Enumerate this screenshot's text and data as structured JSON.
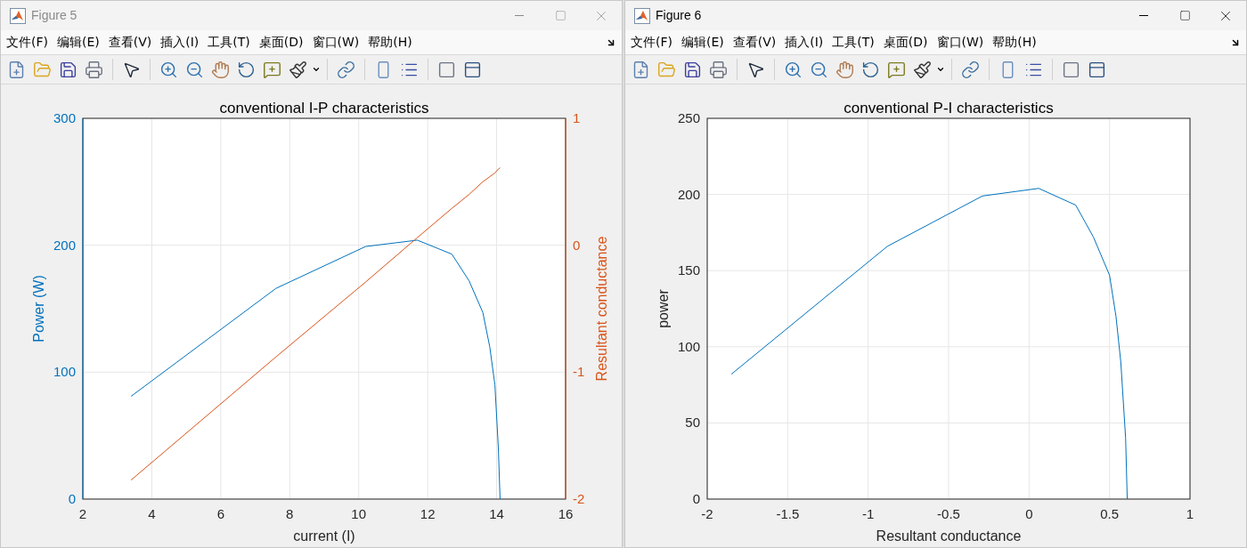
{
  "windows": [
    {
      "title": "Figure 5",
      "active": false,
      "menu": [
        "文件(F)",
        "编辑(E)",
        "查看(V)",
        "插入(I)",
        "工具(T)",
        "桌面(D)",
        "窗口(W)",
        "帮助(H)"
      ],
      "chart_data": {
        "type": "line",
        "title": "conventional I-P characteristics",
        "xlabel": "current (I)",
        "ylabel": "Power (W)",
        "y2label": "Resultant conductance",
        "x": [
          3.4,
          7.6,
          10.2,
          11.7,
          12.7,
          13.2,
          13.6,
          13.8,
          13.95,
          14.05,
          14.1
        ],
        "series": [
          {
            "color": "#0072bd",
            "values": [
              81,
              166,
              199,
              204,
              193,
              172,
              147,
              120,
              90,
              40,
              0
            ]
          },
          {
            "color": "#d95319",
            "axis": "y2",
            "values": [
              -1.85,
              -0.88,
              -0.29,
              0.06,
              0.29,
              0.4,
              0.5,
              0.54,
              0.57,
              0.6,
              0.61
            ]
          }
        ],
        "grid": true,
        "xlim": [
          2,
          16
        ],
        "ylim": [
          0,
          300
        ],
        "y2lim": [
          -2,
          1
        ],
        "xticks": [
          2,
          4,
          6,
          8,
          10,
          12,
          14,
          16
        ],
        "yticks": [
          0,
          100,
          200,
          300
        ],
        "y2ticks": [
          -2,
          -1,
          0,
          1
        ]
      }
    },
    {
      "title": "Figure 6",
      "active": true,
      "menu": [
        "文件(F)",
        "编辑(E)",
        "查看(V)",
        "插入(I)",
        "工具(T)",
        "桌面(D)",
        "窗口(W)",
        "帮助(H)"
      ],
      "chart_data": {
        "type": "line",
        "title": "conventional P-I characteristics",
        "xlabel": "Resultant conductance",
        "ylabel": "power",
        "x": [
          -1.85,
          -0.88,
          -0.29,
          0.06,
          0.29,
          0.4,
          0.5,
          0.54,
          0.57,
          0.6,
          0.61
        ],
        "series": [
          {
            "color": "#0072bd",
            "values": [
              82,
              166,
              199,
              204,
              193,
              172,
              147,
              120,
              90,
              40,
              0
            ]
          }
        ],
        "grid": true,
        "xlim": [
          -2,
          1
        ],
        "ylim": [
          0,
          250
        ],
        "xticks": [
          -2,
          -1.5,
          -1,
          -0.5,
          0,
          0.5,
          1
        ],
        "yticks": [
          0,
          50,
          100,
          150,
          200,
          250
        ]
      }
    }
  ]
}
